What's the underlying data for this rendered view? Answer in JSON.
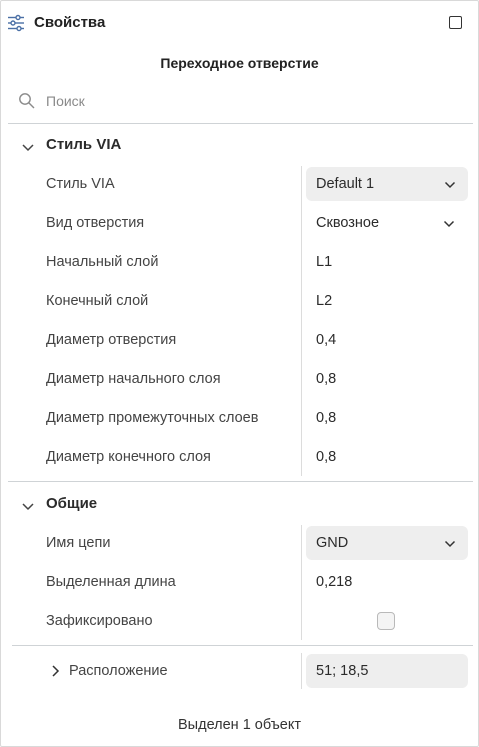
{
  "header": {
    "title": "Свойства"
  },
  "subtitle": "Переходное отверстие",
  "search": {
    "placeholder": "Поиск"
  },
  "sections": [
    {
      "title": "Стиль VIA",
      "rows": [
        {
          "label": "Стиль VIA",
          "value": "Default 1",
          "kind": "select"
        },
        {
          "label": "Вид отверстия",
          "value": "Сквозное",
          "kind": "dropdown"
        },
        {
          "label": "Начальный слой",
          "value": "L1"
        },
        {
          "label": "Конечный слой",
          "value": "L2"
        },
        {
          "label": "Диаметр отверстия",
          "value": "0,4"
        },
        {
          "label": "Диаметр начального слоя",
          "value": "0,8"
        },
        {
          "label": "Диаметр промежуточных слоев",
          "value": "0,8"
        },
        {
          "label": "Диаметр конечного слоя",
          "value": "0,8"
        }
      ]
    },
    {
      "title": "Общие",
      "rows": [
        {
          "label": "Имя цепи",
          "value": "GND",
          "kind": "select"
        },
        {
          "label": "Выделенная длина",
          "value": "0,218"
        },
        {
          "label": "Зафиксировано",
          "checked": false,
          "kind": "checkbox"
        }
      ]
    }
  ],
  "location": {
    "label": "Расположение",
    "value": "51; 18,5"
  },
  "footer": "Выделен 1 объект",
  "colors": {
    "select_bg": "#eeeeee",
    "divider": "#cfd3d6",
    "text": "#2b2b2b"
  }
}
